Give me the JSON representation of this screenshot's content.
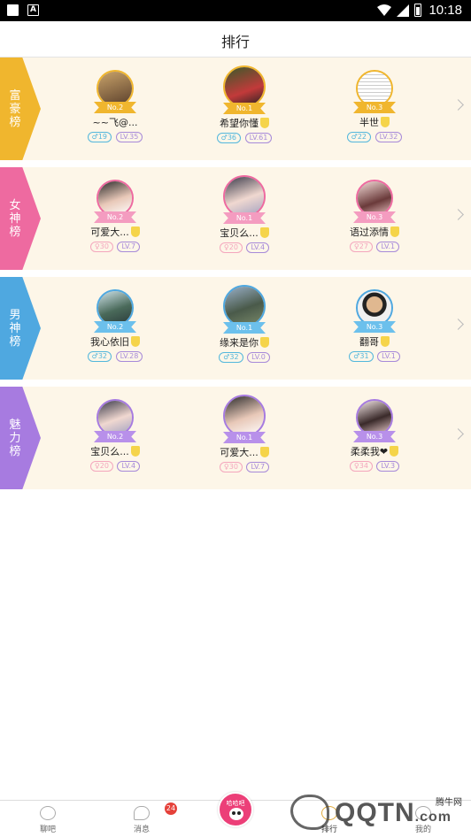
{
  "status_bar": {
    "time": "10:18"
  },
  "header": {
    "title": "排行"
  },
  "rankings": [
    {
      "label": "富豪榜",
      "color": "#f0b62e",
      "entries": [
        {
          "rank": "No.2",
          "name": "~~飞@...",
          "gender": "♂",
          "number": "19",
          "level": "LV.35"
        },
        {
          "rank": "No.1",
          "name": "希望你懂",
          "gender": "♂",
          "number": "36",
          "level": "LV.61"
        },
        {
          "rank": "No.3",
          "name": "半世",
          "gender": "♂",
          "number": "22",
          "level": "LV.32"
        }
      ]
    },
    {
      "label": "女神榜",
      "color": "#ee6aa0",
      "entries": [
        {
          "rank": "No.2",
          "name": "可爱大...",
          "gender": "♀",
          "number": "30",
          "level": "LV.7"
        },
        {
          "rank": "No.1",
          "name": "宝贝么...",
          "gender": "♀",
          "number": "20",
          "level": "LV.4"
        },
        {
          "rank": "No.3",
          "name": "语过添情",
          "gender": "♀",
          "number": "27",
          "level": "LV.1"
        }
      ]
    },
    {
      "label": "男神榜",
      "color": "#4fa8e0",
      "entries": [
        {
          "rank": "No.2",
          "name": "我心依旧",
          "gender": "♂",
          "number": "32",
          "level": "LV.28"
        },
        {
          "rank": "No.1",
          "name": "缘来是你",
          "gender": "♂",
          "number": "32",
          "level": "LV.0"
        },
        {
          "rank": "No.3",
          "name": "翻哥",
          "gender": "♂",
          "number": "31",
          "level": "LV.1"
        }
      ]
    },
    {
      "label": "魅力榜",
      "color": "#a77be0",
      "entries": [
        {
          "rank": "No.2",
          "name": "宝贝么...",
          "gender": "♀",
          "number": "20",
          "level": "LV.4"
        },
        {
          "rank": "No.1",
          "name": "可爱大...",
          "gender": "♀",
          "number": "30",
          "level": "LV.7"
        },
        {
          "rank": "No.3",
          "name": "柔柔我❤",
          "gender": "♀",
          "number": "34",
          "level": "LV.3"
        }
      ]
    }
  ],
  "tabbar": {
    "tabs": [
      {
        "label": "聊吧"
      },
      {
        "label": "消息",
        "badge": "24"
      },
      {
        "label": "哈哈吧"
      },
      {
        "label": "排行"
      },
      {
        "label": "我的"
      }
    ]
  },
  "watermark": {
    "text": "QQTN",
    "suffix": ".com",
    "sub": "腾牛网"
  }
}
